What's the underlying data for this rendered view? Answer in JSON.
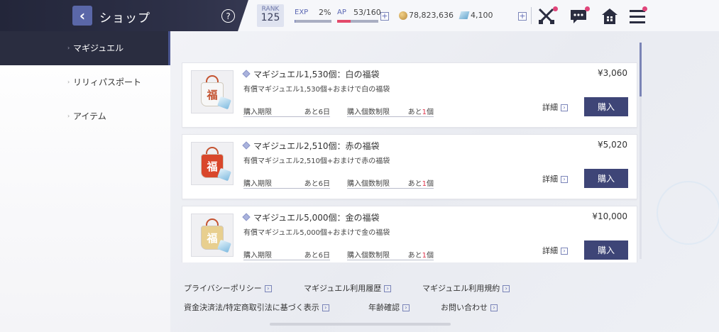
{
  "header": {
    "back_icon": "chevron-left-icon",
    "title": "ショップ",
    "help_label": "?",
    "rank_label": "RANK",
    "rank_value": "125",
    "exp_label": "EXP",
    "exp_value": "2%",
    "exp_fraction": 0.02,
    "ap_label": "AP",
    "ap_value": "53/160",
    "ap_fraction": 0.33,
    "plus_label": "+",
    "coin_value": "78,823,636",
    "jewel_value": "4,100",
    "icons": [
      "crossed-swords-icon",
      "chat-icon",
      "home-icon",
      "menu-icon"
    ],
    "accent_color": "#3e4577",
    "notification_color": "#e0457a"
  },
  "sidebar": {
    "items": [
      {
        "label": "マギジュエル",
        "active": true
      },
      {
        "label": "リリィパスポート",
        "active": false
      },
      {
        "label": "アイテム",
        "active": false
      }
    ]
  },
  "products": [
    {
      "name": "マギジュエル1,530個：白の福袋",
      "price": "¥3,060",
      "description": "有償マギジュエル1,530個+おまけで白の福袋",
      "period_label": "購入期限",
      "period_value": "あと6日",
      "limit_label": "購入個数制限",
      "limit_prefix": "あと",
      "limit_count": "1",
      "limit_suffix": "個",
      "detail_label": "詳細",
      "buy_label": "購入",
      "bag_char": "福",
      "bag_color": "#f7f7f7",
      "bag_text_color": "#c4522f"
    },
    {
      "name": "マギジュエル2,510個：赤の福袋",
      "price": "¥5,020",
      "description": "有償マギジュエル2,510個+おまけで赤の福袋",
      "period_label": "購入期限",
      "period_value": "あと6日",
      "limit_label": "購入個数制限",
      "limit_prefix": "あと",
      "limit_count": "1",
      "limit_suffix": "個",
      "detail_label": "詳細",
      "buy_label": "購入",
      "bag_char": "福",
      "bag_color": "#d9472b",
      "bag_text_color": "#ffffff"
    },
    {
      "name": "マギジュエル5,000個：金の福袋",
      "price": "¥10,000",
      "description": "有償マギジュエル5,000個+おまけで金の福袋",
      "period_label": "購入期限",
      "period_value": "あと6日",
      "limit_label": "購入個数制限",
      "limit_prefix": "あと",
      "limit_count": "1",
      "limit_suffix": "個",
      "detail_label": "詳細",
      "buy_label": "購入",
      "bag_char": "福",
      "bag_color": "#e8cf8f",
      "bag_text_color": "#ffffff"
    }
  ],
  "footer": {
    "links": [
      "プライバシーポリシー",
      "マギジュエル利用履歴",
      "マギジュエル利用規約",
      "資金決済法/特定商取引法に基づく表示",
      "年齢確認",
      "お問い合わせ"
    ],
    "arrow": "›"
  }
}
